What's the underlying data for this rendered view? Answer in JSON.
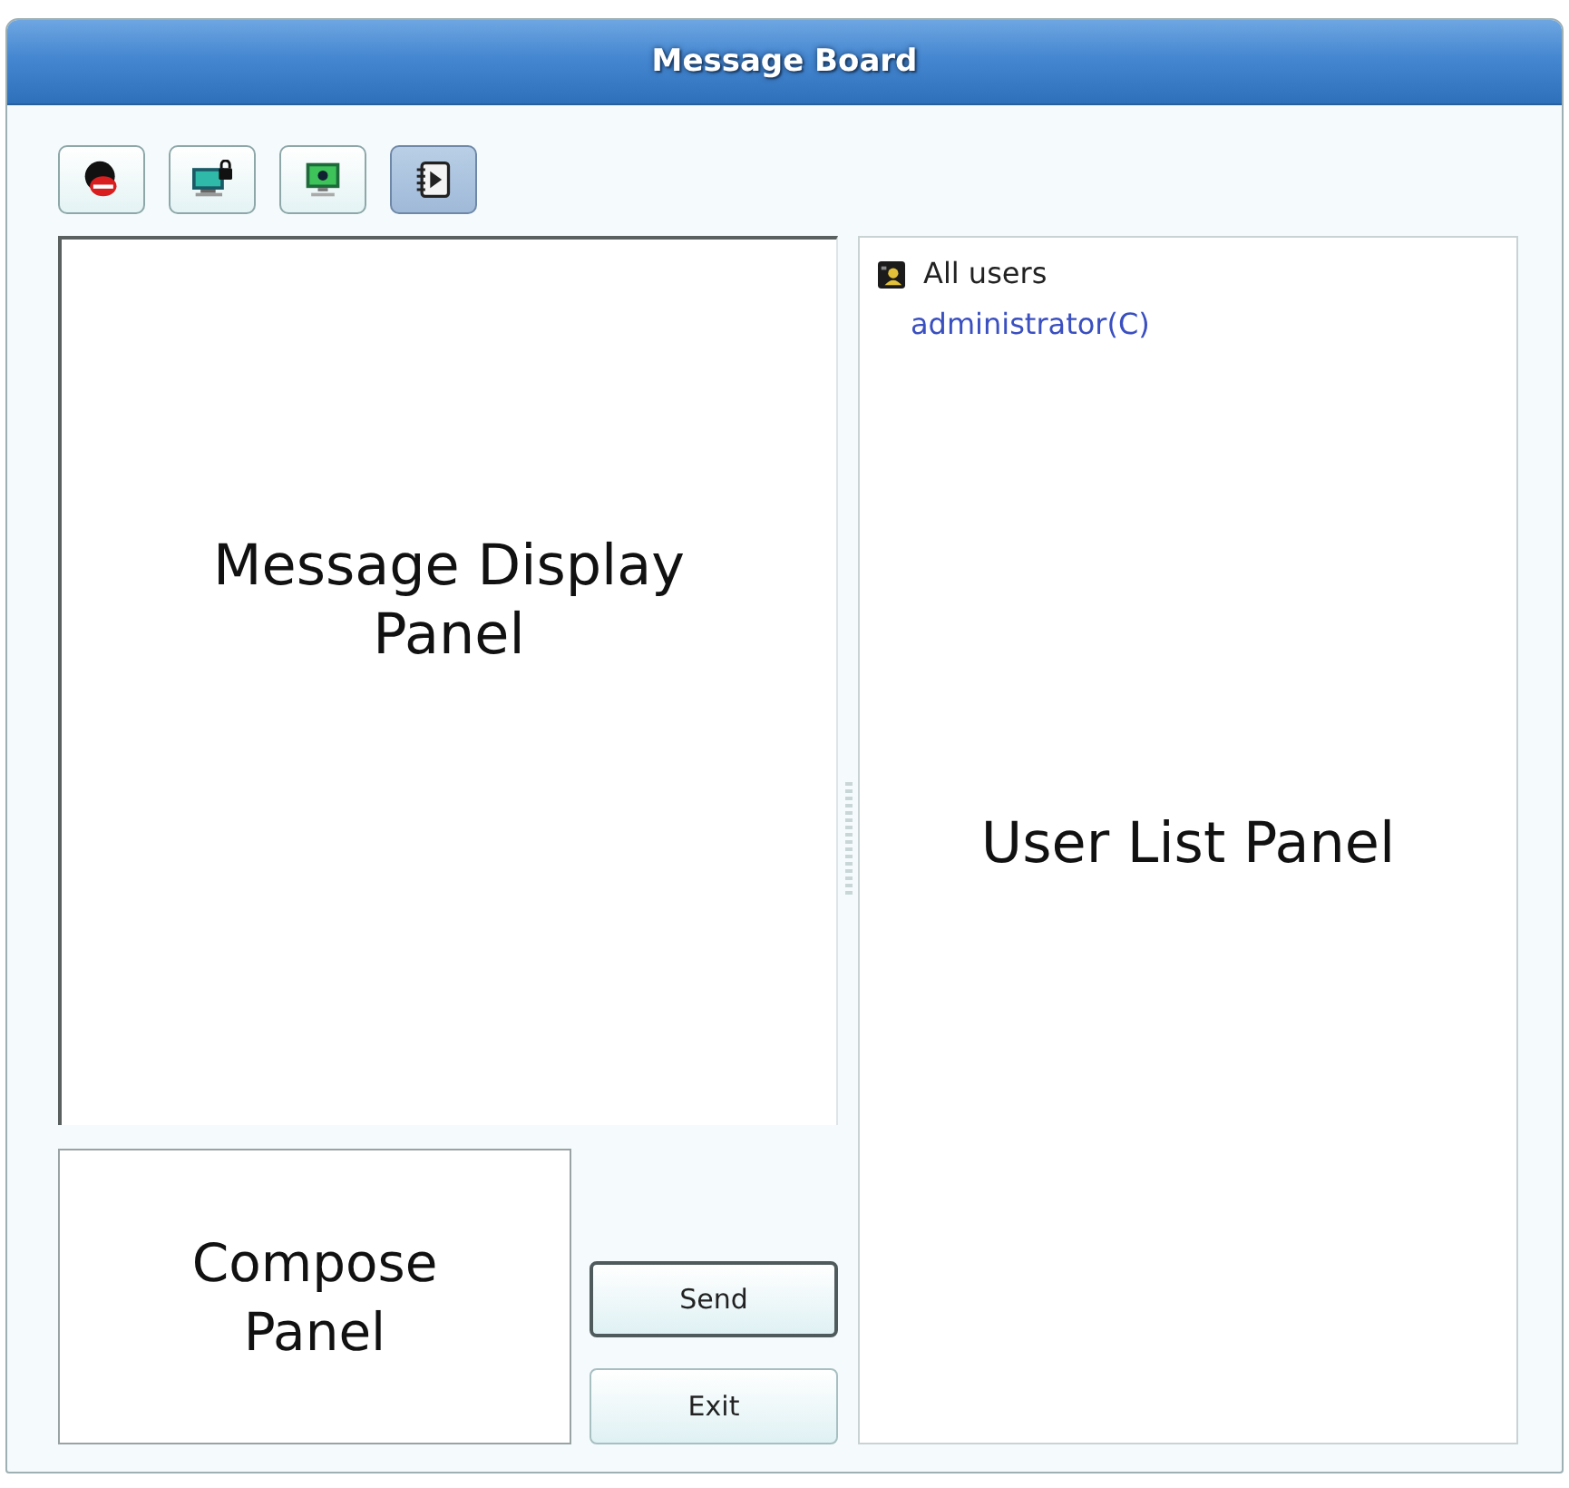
{
  "window": {
    "title": "Message Board"
  },
  "toolbar": {
    "buttons": [
      {
        "kind": "user_block",
        "selected": false
      },
      {
        "kind": "monitor_lock",
        "selected": false
      },
      {
        "kind": "monitor",
        "selected": false
      },
      {
        "kind": "notebook_play",
        "selected": true
      }
    ]
  },
  "message_display": {
    "label": "Message Display Panel"
  },
  "user_list": {
    "items": [
      {
        "kind": "group",
        "label": "All users"
      },
      {
        "kind": "user",
        "label": "administrator(C)"
      }
    ],
    "label": "User List Panel"
  },
  "compose": {
    "label": "Compose Panel"
  },
  "buttons": [
    {
      "kind": "default",
      "label": "Send"
    },
    {
      "kind": "normal",
      "label": "Exit"
    }
  ]
}
